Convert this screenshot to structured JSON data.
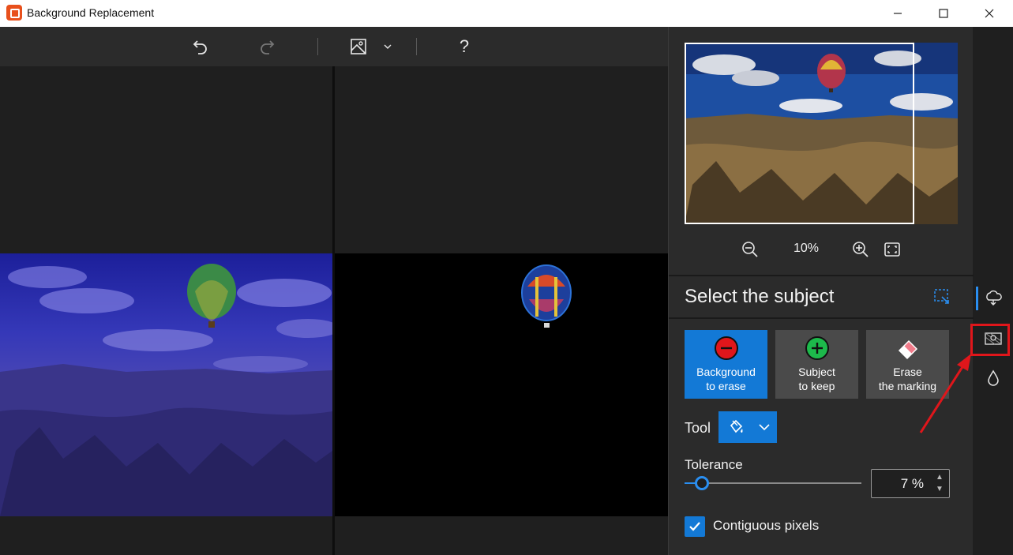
{
  "window": {
    "title": "Background Replacement",
    "controls": [
      "minimize",
      "maximize",
      "close"
    ]
  },
  "toolbar": {
    "undo_icon": "undo-icon",
    "redo_icon": "redo-icon",
    "view_icon": "image-view-icon",
    "help_label": "?"
  },
  "preview": {
    "zoom_level": "10%",
    "zoom_out_icon": "zoom-out-icon",
    "zoom_in_icon": "zoom-in-icon",
    "fit_icon": "fit-screen-icon"
  },
  "panel": {
    "title": "Select the subject",
    "modes": [
      {
        "label": "Background\nto erase",
        "icon": "minus-circle-icon",
        "icon_color": "#e0161b",
        "active": true
      },
      {
        "label": "Subject\nto keep",
        "icon": "plus-circle-icon",
        "icon_color": "#1db94b",
        "active": false
      },
      {
        "label": "Erase\nthe marking",
        "icon": "eraser-icon",
        "icon_color": "#f07b8a",
        "active": false
      }
    ],
    "tool_label": "Tool",
    "tolerance_label": "Tolerance",
    "tolerance_value": "7 %",
    "tolerance_percent": 7,
    "contiguous_label": "Contiguous pixels",
    "contiguous_checked": true
  },
  "rail": {
    "items": [
      "select-subject-icon",
      "background-icon",
      "water-drop-icon"
    ]
  },
  "colors": {
    "accent": "#1379d6",
    "highlight": "#e0161b"
  }
}
